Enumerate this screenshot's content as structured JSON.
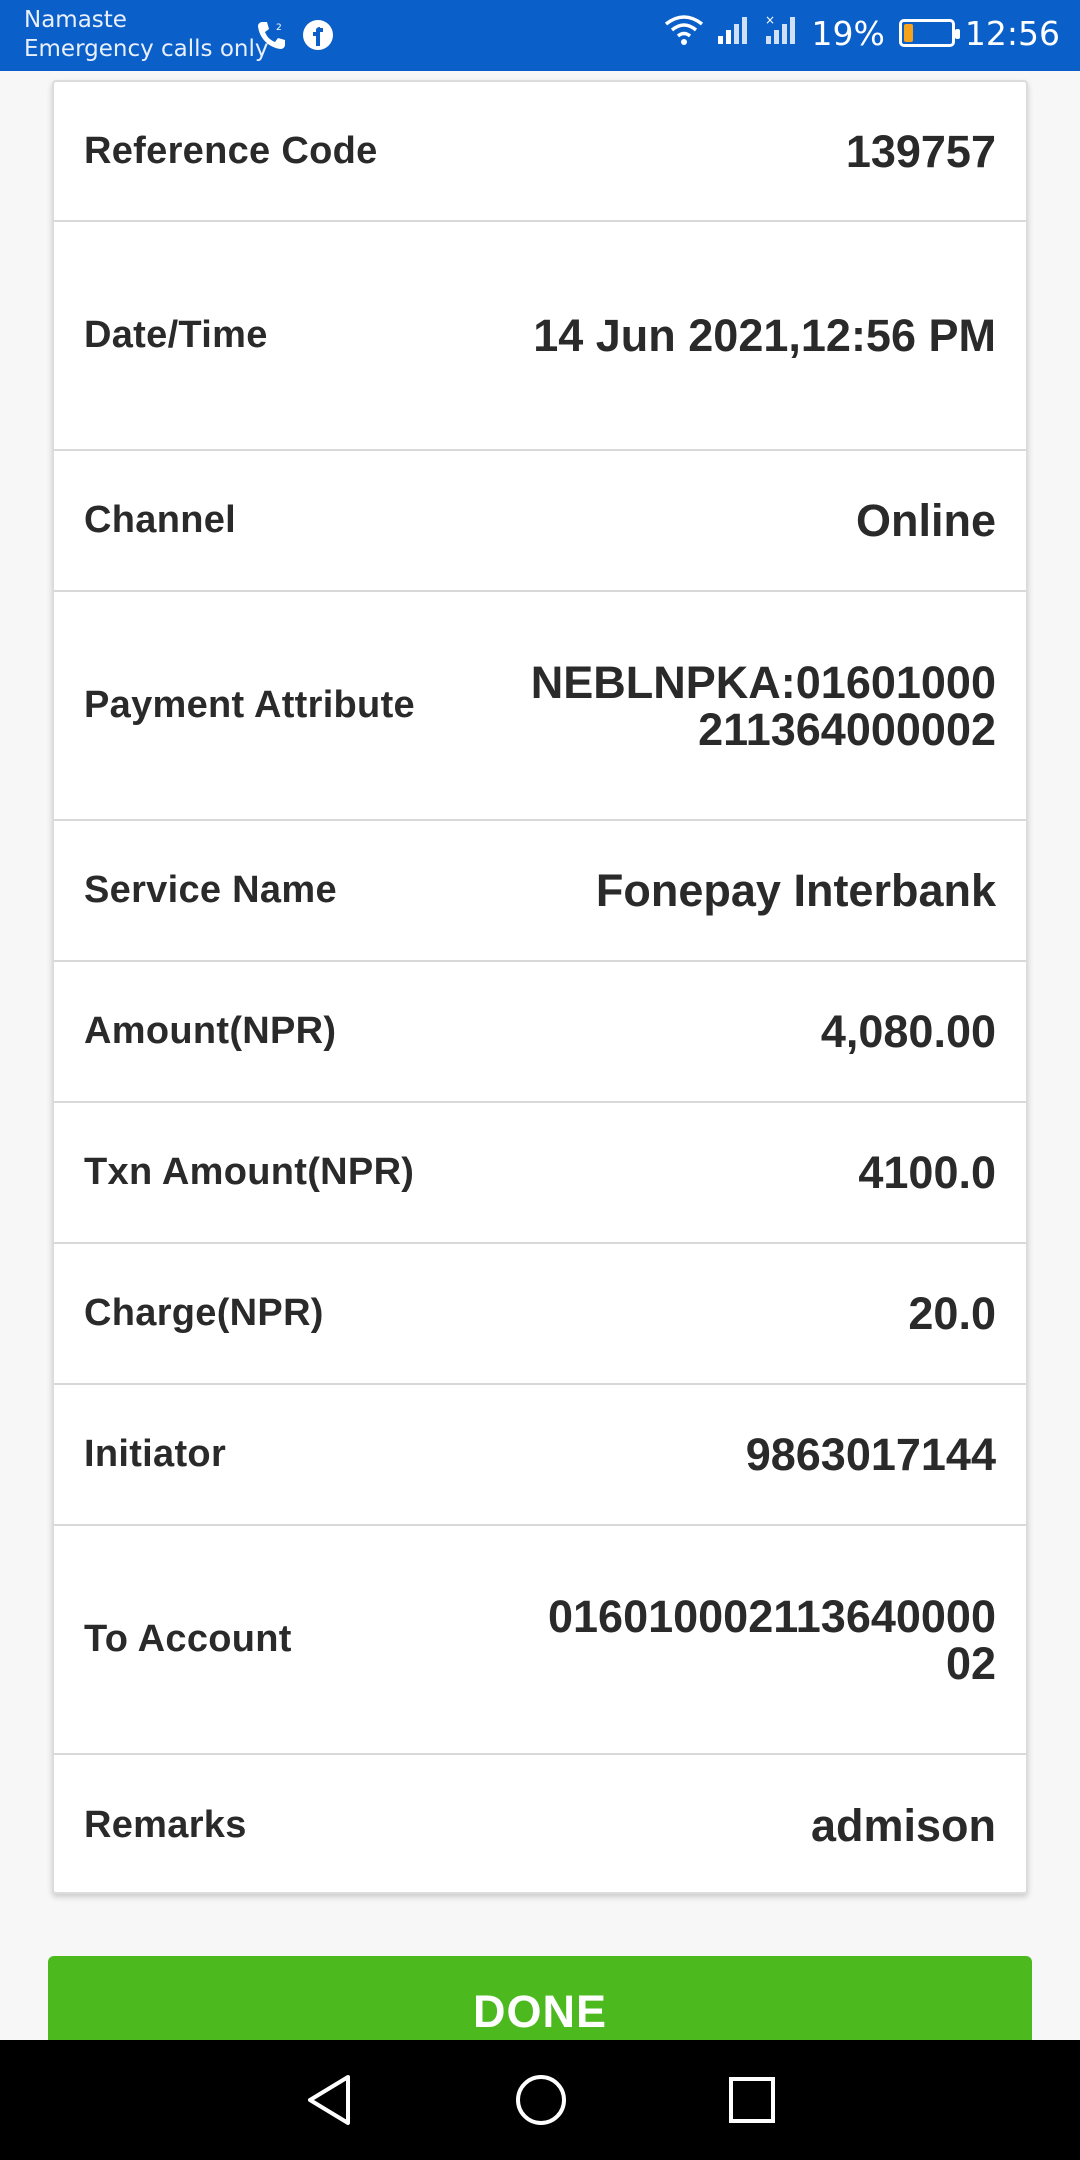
{
  "status_bar": {
    "carrier": "Namaste",
    "emergency": "Emergency calls only",
    "battery_percent": "19%",
    "battery_level": 0.19,
    "time": "12:56",
    "bg_color": "#0a5fc9",
    "icons": [
      "wifi-calling-icon",
      "facebook-icon",
      "wifi-icon",
      "signal-icon",
      "signal-no-service-icon",
      "battery-icon"
    ]
  },
  "details": {
    "rows": [
      {
        "label": "Reference Code",
        "value": "139757"
      },
      {
        "label": "Date/Time",
        "value": "14 Jun 2021,12:56 PM"
      },
      {
        "label": "Channel",
        "value": "Online"
      },
      {
        "label": "Payment Attribute",
        "value": "NEBLNPKA:01601000211364000002"
      },
      {
        "label": "Service Name",
        "value": "Fonepay Interbank"
      },
      {
        "label": "Amount(NPR)",
        "value": "4,080.00"
      },
      {
        "label": "Txn Amount(NPR)",
        "value": "4100.0"
      },
      {
        "label": "Charge(NPR)",
        "value": "20.0"
      },
      {
        "label": "Initiator",
        "value": "9863017144"
      },
      {
        "label": "To Account",
        "value": "01601000211364000002"
      },
      {
        "label": "Remarks",
        "value": "admison"
      }
    ]
  },
  "done_button": {
    "label": "DONE",
    "color": "#4cba1f"
  },
  "nav_bar": {
    "icons": [
      "back-icon",
      "home-icon",
      "recents-icon"
    ]
  }
}
